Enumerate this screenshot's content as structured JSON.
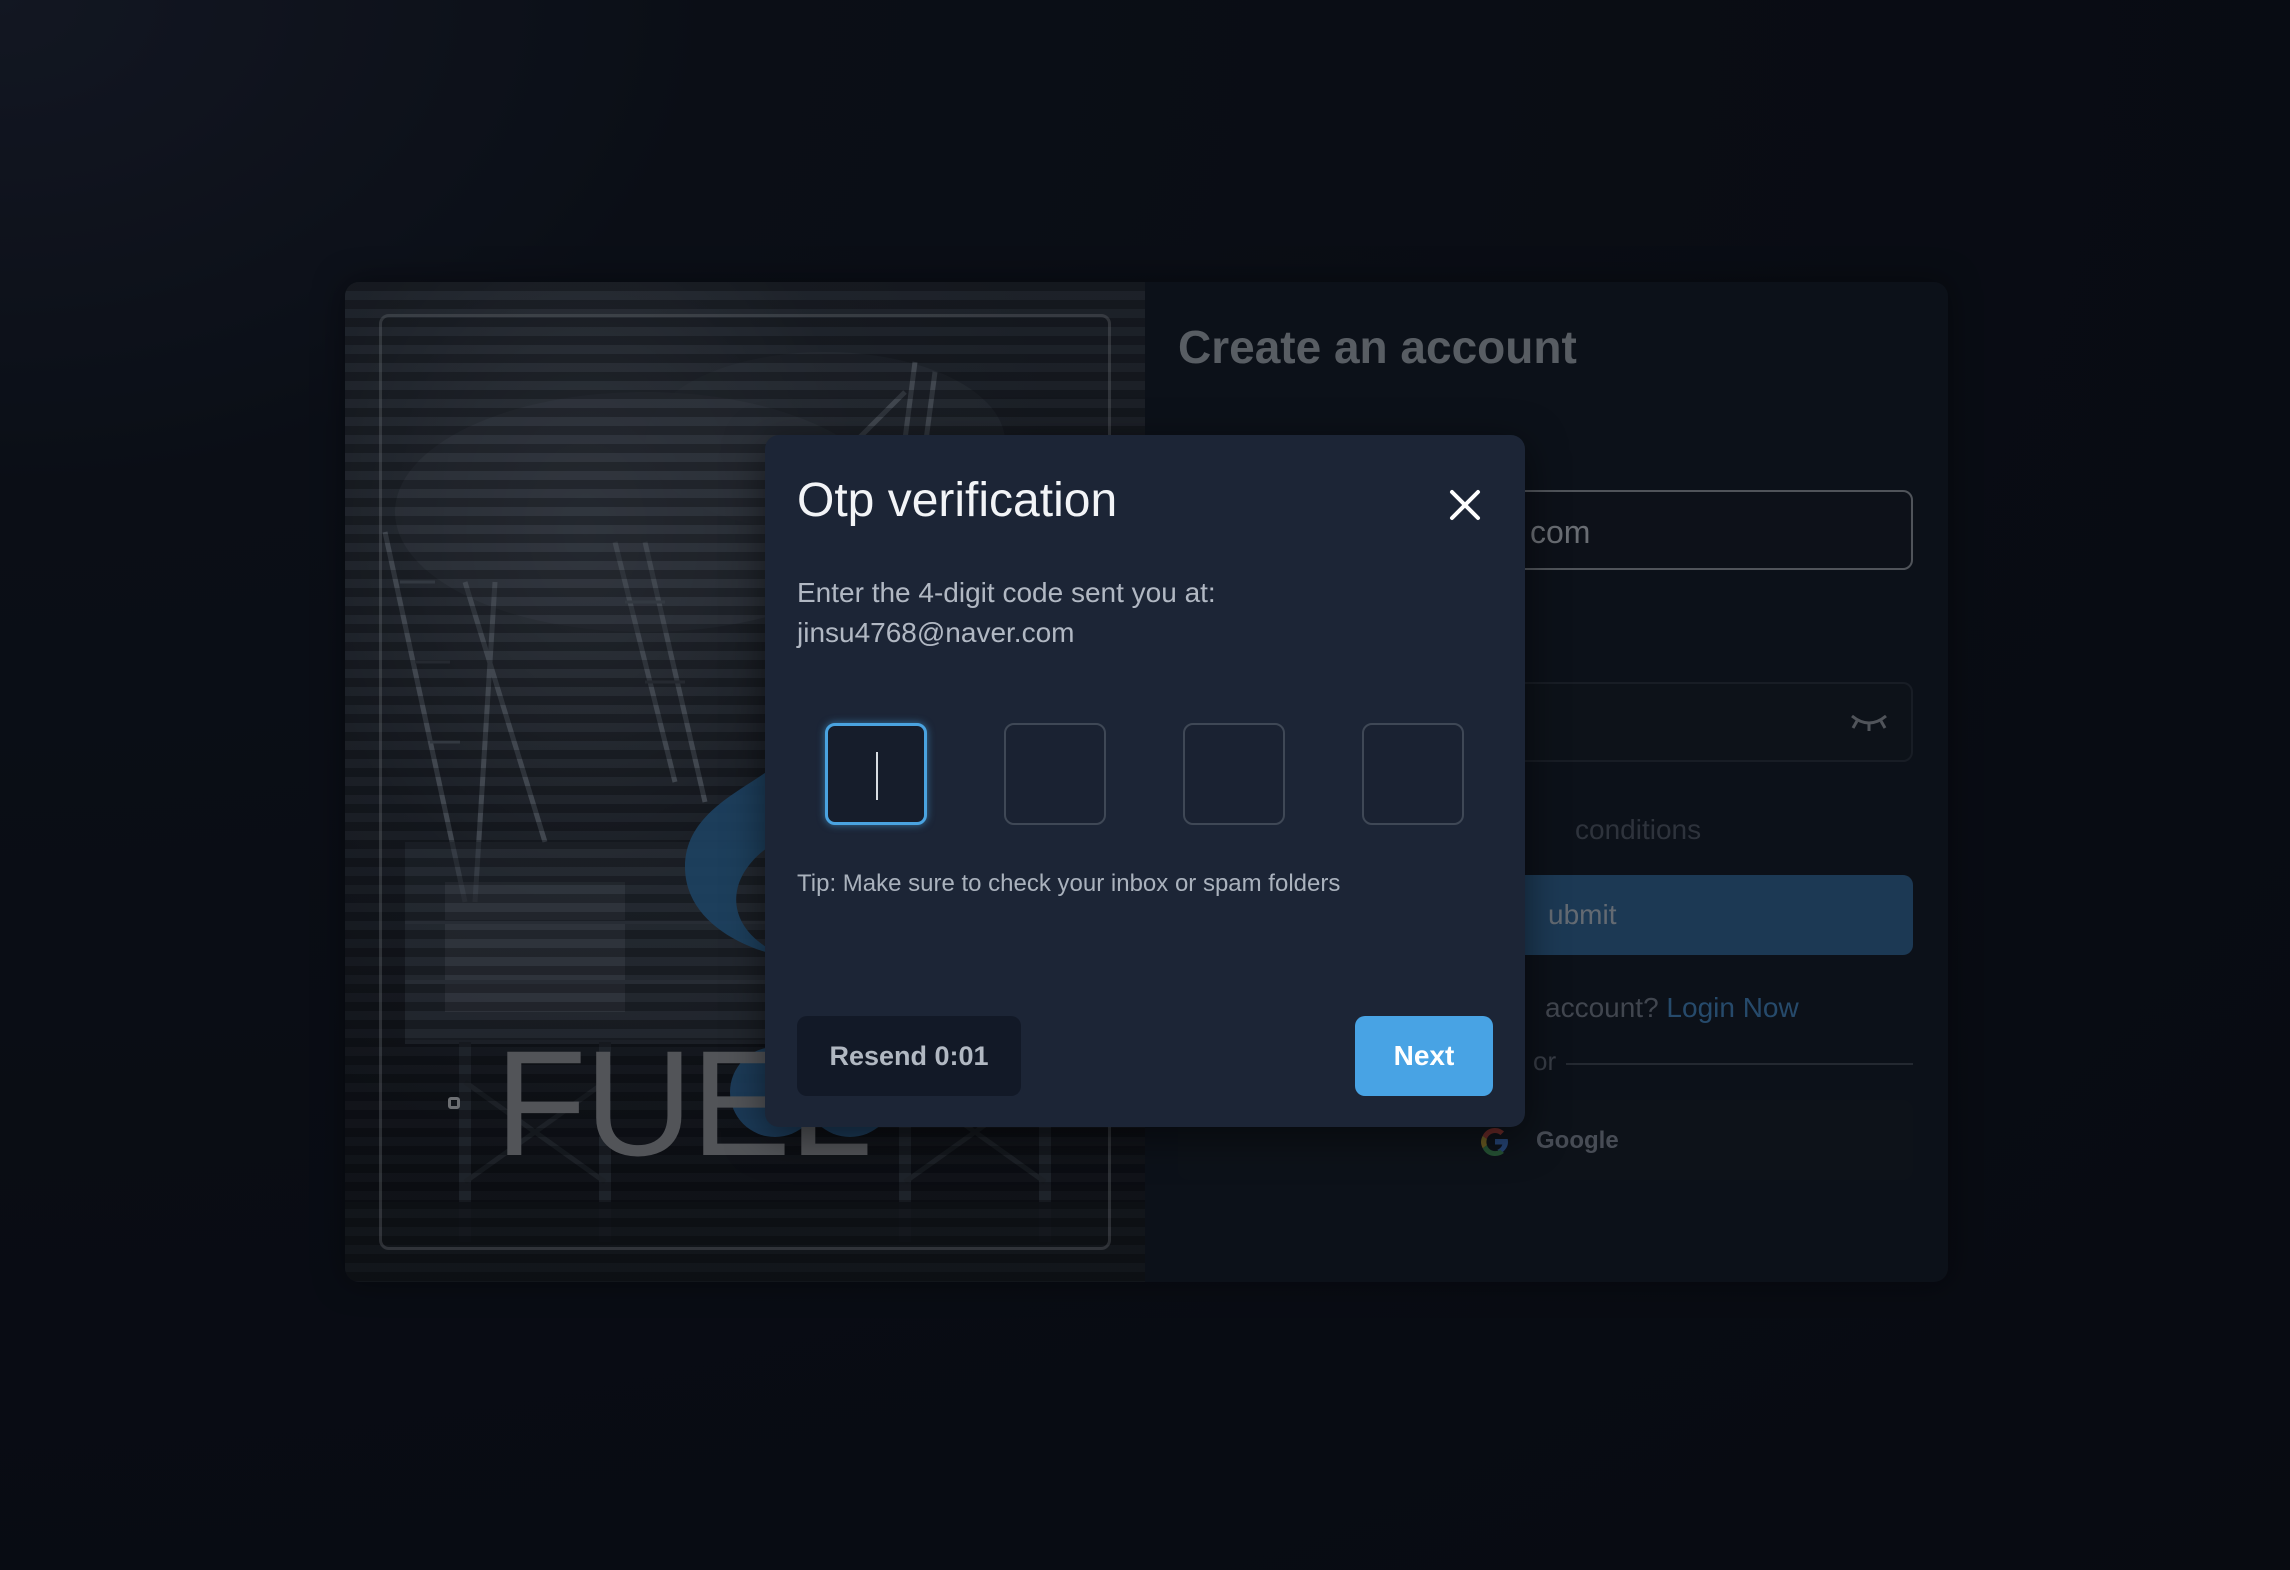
{
  "signup": {
    "title": "Create an account",
    "email_value_visible": "com",
    "terms_text": "conditions",
    "submit_label": "ubmit",
    "login_prompt": "account?",
    "login_link": "Login Now",
    "divider_text": "or",
    "google_label": "Google"
  },
  "hero": {
    "logo_text": "FUEL",
    "icon": "fuel-drop-logo"
  },
  "otp_modal": {
    "title": "Otp verification",
    "instruction": "Enter the 4-digit code sent you at:",
    "email": "jinsu4768@naver.com",
    "digits": [
      "",
      "",
      "",
      ""
    ],
    "active_digit": 1,
    "tip": "Tip: Make sure to check your inbox or spam folders",
    "resend_label": "Resend 0:01",
    "next_label": "Next",
    "close_icon": "close-icon"
  },
  "colors": {
    "accent": "#48a3e4",
    "modal_bg": "#1c2536",
    "page_bg": "#0b0f17"
  }
}
